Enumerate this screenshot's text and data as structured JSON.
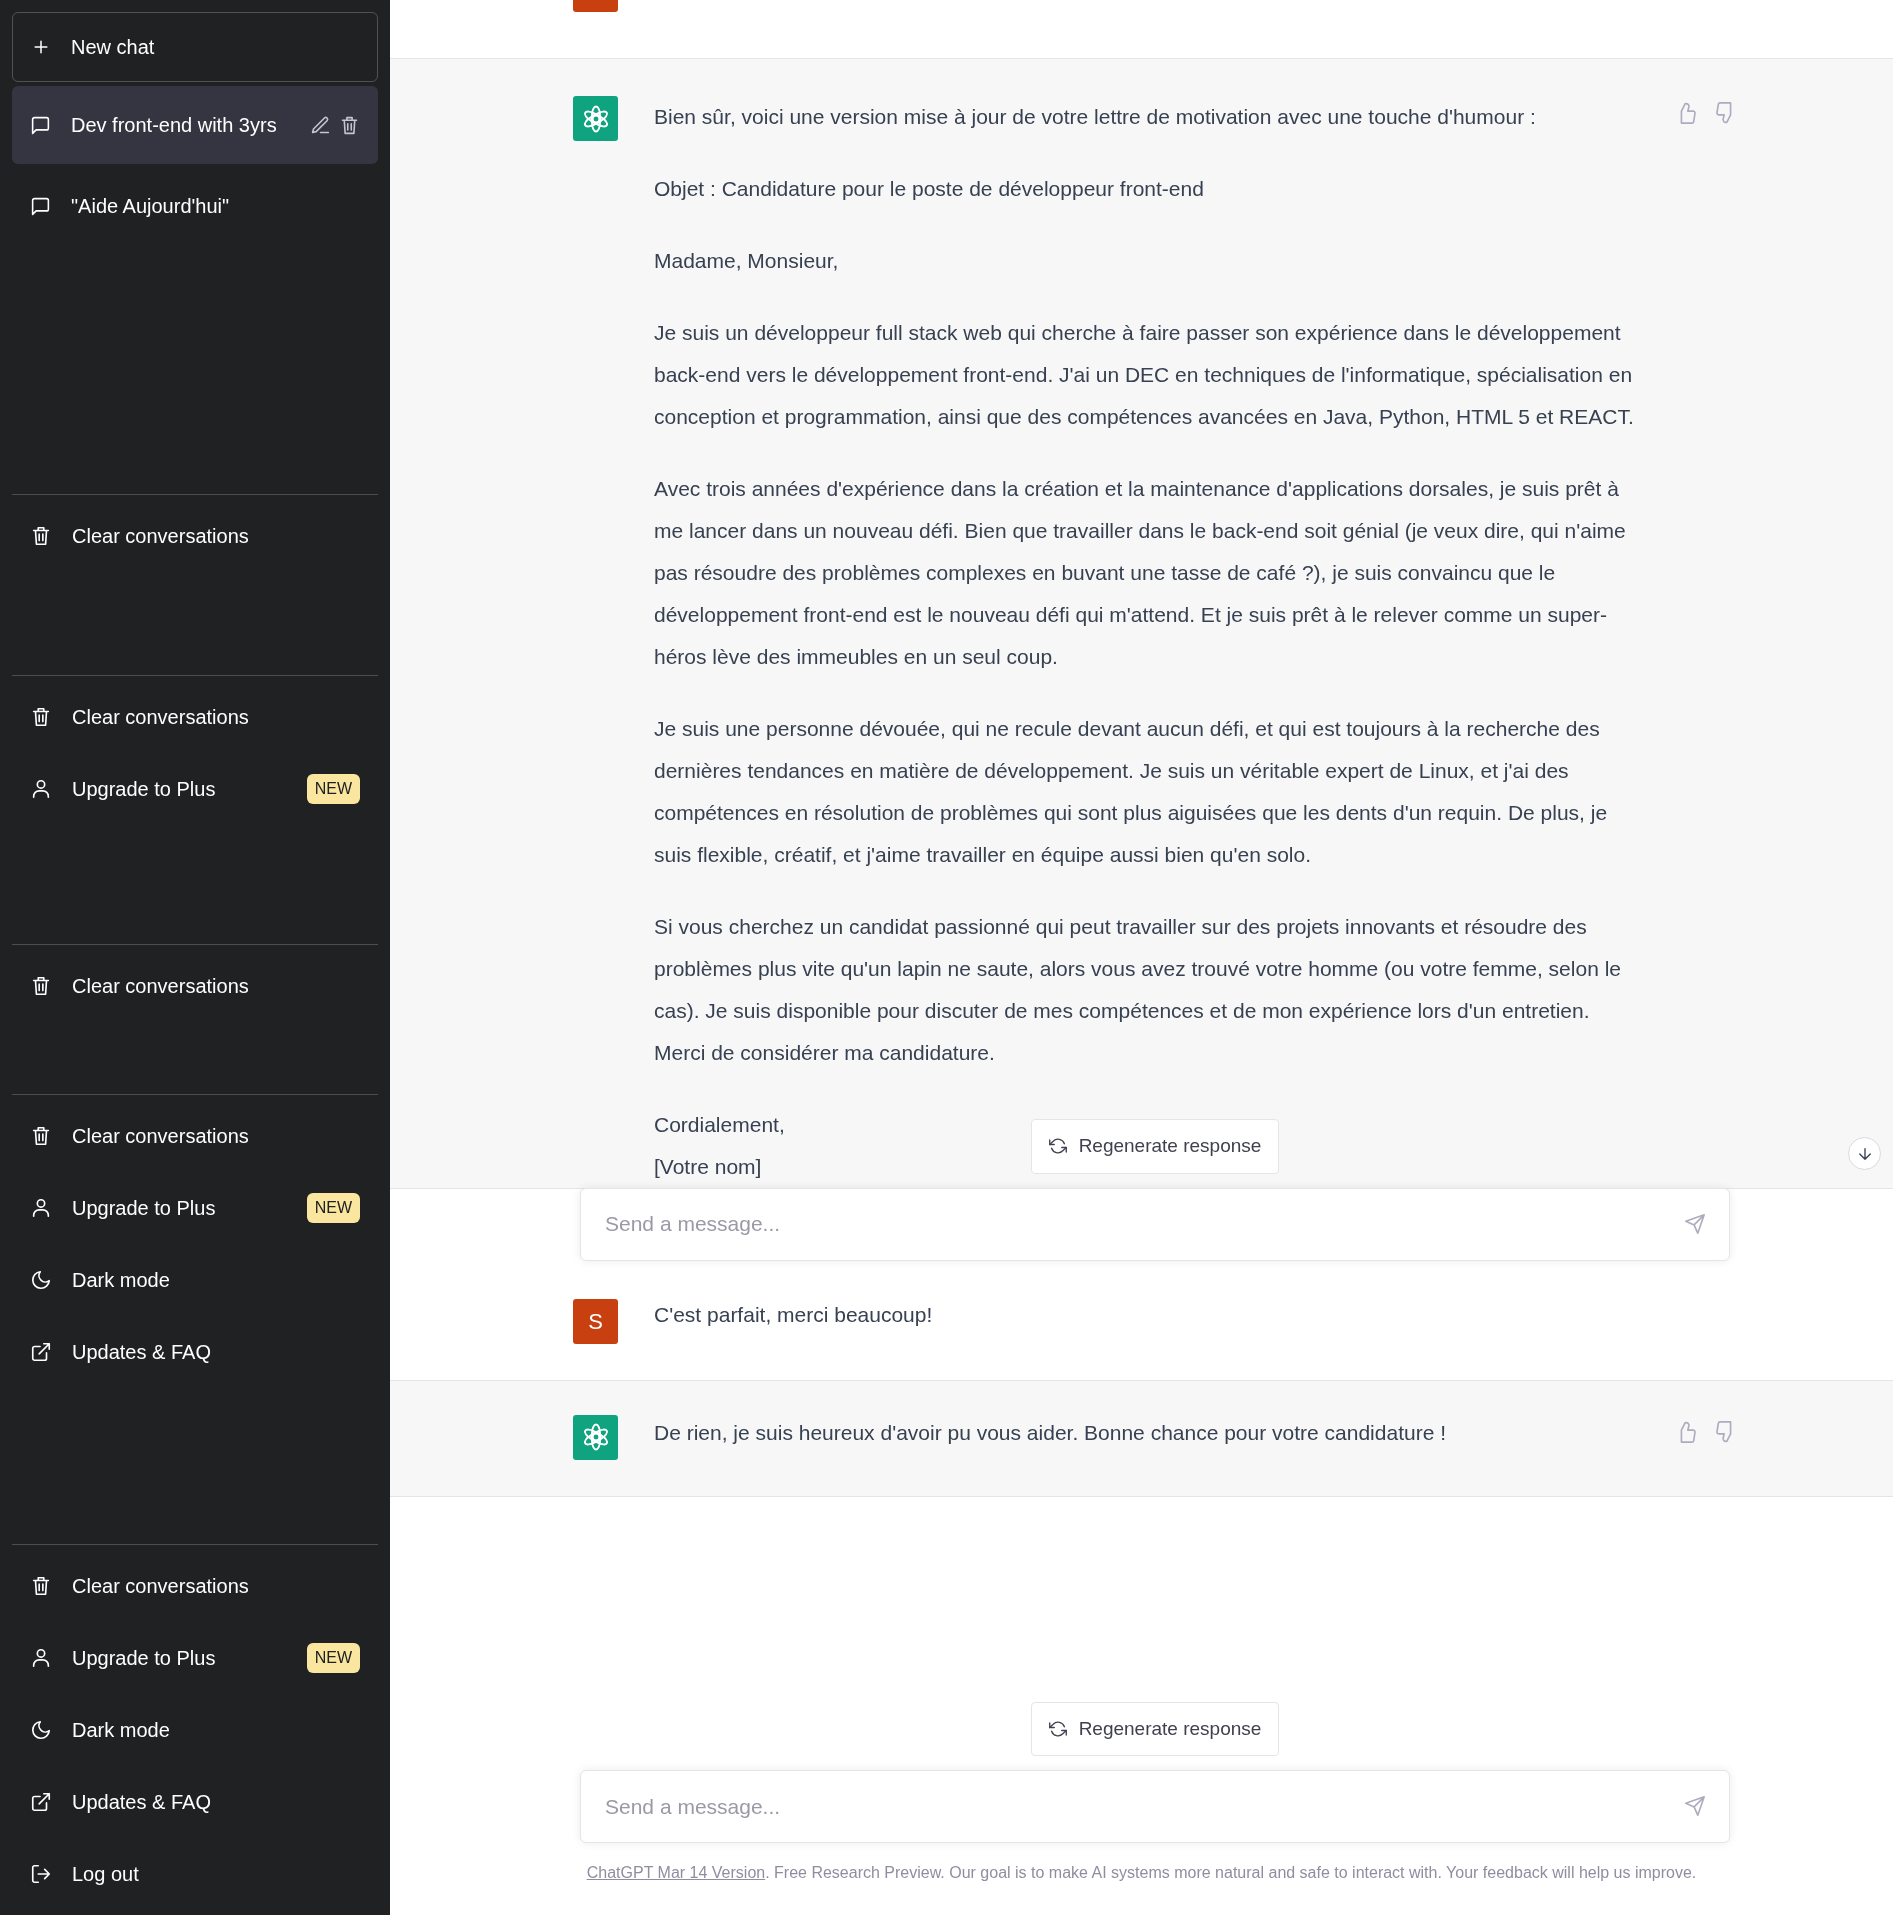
{
  "sidebar": {
    "new_chat": "New chat",
    "conversations": [
      {
        "title": "Dev front-end with 3yrs",
        "selected": true
      },
      {
        "title": "\"Aide Aujourd'hui\"",
        "selected": false
      }
    ],
    "sections": [
      {
        "items": [
          {
            "kind": "clear",
            "label": "Clear conversations"
          }
        ]
      },
      {
        "items": [
          {
            "kind": "clear",
            "label": "Clear conversations"
          },
          {
            "kind": "upgrade",
            "label": "Upgrade to Plus",
            "badge": "NEW"
          }
        ]
      },
      {
        "items": [
          {
            "kind": "clear",
            "label": "Clear conversations"
          }
        ]
      },
      {
        "items": [
          {
            "kind": "clear",
            "label": "Clear conversations"
          },
          {
            "kind": "upgrade",
            "label": "Upgrade to Plus",
            "badge": "NEW"
          },
          {
            "kind": "dark",
            "label": "Dark mode"
          },
          {
            "kind": "updates",
            "label": "Updates & FAQ"
          }
        ]
      },
      {
        "items": [
          {
            "kind": "clear",
            "label": "Clear conversations"
          },
          {
            "kind": "upgrade",
            "label": "Upgrade to Plus",
            "badge": "NEW"
          },
          {
            "kind": "dark",
            "label": "Dark mode"
          },
          {
            "kind": "updates",
            "label": "Updates & FAQ"
          },
          {
            "kind": "logout",
            "label": "Log out"
          }
        ]
      }
    ]
  },
  "messages": [
    {
      "kind": "cut_user"
    },
    {
      "kind": "assistant",
      "paragraphs": [
        "Bien sûr, voici une version mise à jour de votre lettre de motivation avec une touche d'humour :",
        "Objet : Candidature pour le poste de développeur front-end",
        "Madame, Monsieur,",
        "Je suis un développeur full stack web qui cherche à faire passer son expérience dans le développement back-end vers le développement front-end. J'ai un DEC en techniques de l'informatique, spécialisation en conception et programmation, ainsi que des compétences avancées en Java, Python, HTML 5 et REACT.",
        "Avec trois années d'expérience dans la création et la maintenance d'applications dorsales, je suis prêt à me lancer dans un nouveau défi. Bien que travailler dans le back-end soit génial (je veux dire, qui n'aime pas résoudre des problèmes complexes en buvant une tasse de café ?), je suis convaincu que le développement front-end est le nouveau défi qui m'attend. Et je suis prêt à le relever comme un super-héros lève des immeubles en un seul coup.",
        "Je suis une personne dévouée, qui ne recule devant aucun défi, et qui est toujours à la recherche des dernières tendances en matière de développement. Je suis un véritable expert de Linux, et j'ai des compétences en résolution de problèmes qui sont plus aiguisées que les dents d'un requin. De plus, je suis flexible, créatif, et j'aime travailler en équipe aussi bien qu'en solo.",
        "Si vous cherchez un candidat passionné qui peut travailler sur des projets innovants et résoudre des problèmes plus vite qu'un lapin ne saute, alors vous avez trouvé votre homme (ou votre femme, selon le cas). Je suis disponible pour discuter de mes compétences et de mon expérience lors d'un entretien. Merci de considérer ma candidature.",
        "Cordialement,\n[Votre nom]"
      ]
    },
    {
      "kind": "composer",
      "regenerate": "Regenerate response",
      "placeholder": "Send a message...",
      "scroll_button": true
    },
    {
      "kind": "user",
      "avatar": "S",
      "paragraphs": [
        "C'est parfait, merci beaucoup!"
      ]
    },
    {
      "kind": "assistant",
      "paragraphs": [
        "De rien, je suis heureux d'avoir pu vous aider. Bonne chance pour votre candidature !"
      ]
    },
    {
      "kind": "composer",
      "regenerate": "Regenerate response",
      "placeholder": "Send a message..."
    }
  ],
  "footer": {
    "link": "ChatGPT Mar 14 Version",
    "text": ". Free Research Preview. Our goal is to make AI systems more natural and safe to interact with. Your feedback will help us improve."
  }
}
